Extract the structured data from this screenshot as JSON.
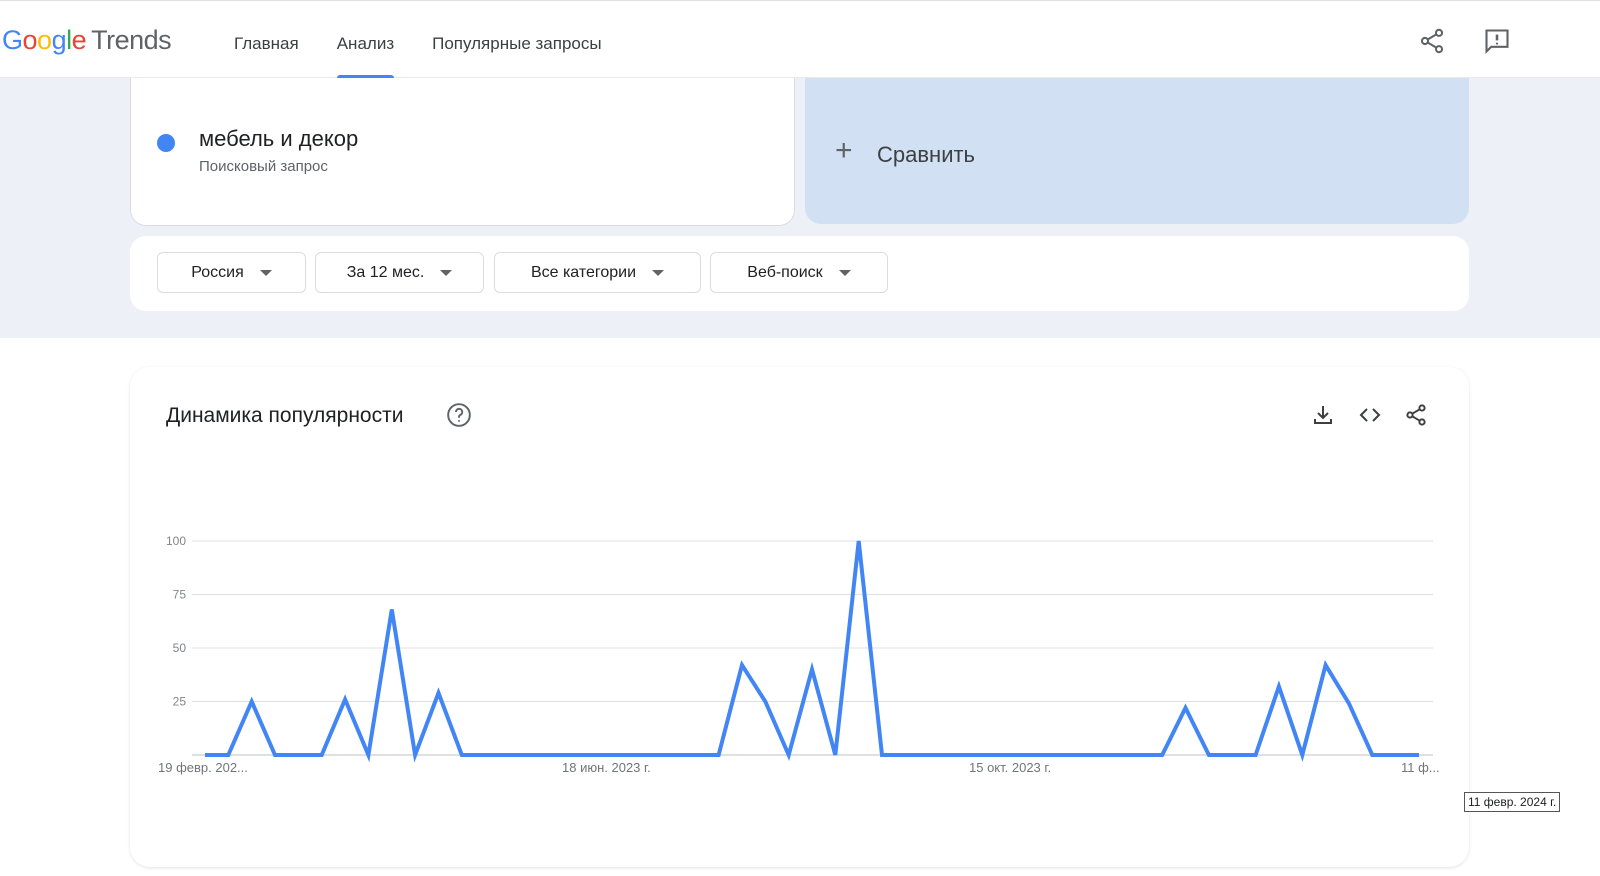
{
  "header": {
    "logo": {
      "g": "G",
      "o1": "o",
      "o2": "o",
      "g2": "g",
      "l": "l",
      "e": "e",
      "product": "Trends"
    },
    "nav": [
      {
        "label": "Главная"
      },
      {
        "label": "Анализ",
        "active": true
      },
      {
        "label": "Популярные запросы"
      }
    ],
    "icons": [
      "share-icon",
      "feedback-icon"
    ]
  },
  "term": {
    "name": "мебель и декор",
    "type": "Поисковый запрос",
    "color": "#4285f4"
  },
  "compare": {
    "label": "Сравнить"
  },
  "filters": [
    {
      "label": "Россия"
    },
    {
      "label": "За 12 мес."
    },
    {
      "label": "Все категории"
    },
    {
      "label": "Веб-поиск"
    }
  ],
  "interest": {
    "title": "Динамика популярности",
    "tools": [
      "download-icon",
      "embed-icon",
      "share-icon"
    ],
    "tooltip": "11 февр. 2024 г."
  },
  "chart_data": {
    "type": "line",
    "x_tick_labels": [
      "19 февр. 202...",
      "18 июн. 2023 г.",
      "15 окт. 2023 г.",
      "11 ф..."
    ],
    "yticks": [
      25,
      50,
      75,
      100
    ],
    "ylim": [
      0,
      100
    ],
    "grid": true,
    "series": [
      {
        "color": "#4285f4",
        "values": [
          0,
          0,
          25,
          0,
          0,
          0,
          26,
          0,
          68,
          0,
          29,
          0,
          0,
          0,
          0,
          0,
          0,
          0,
          0,
          0,
          0,
          0,
          0,
          42,
          25,
          0,
          40,
          0,
          100,
          0,
          0,
          0,
          0,
          0,
          0,
          0,
          0,
          0,
          0,
          0,
          0,
          0,
          22,
          0,
          0,
          0,
          32,
          0,
          42,
          24,
          0,
          0,
          0
        ]
      }
    ]
  }
}
